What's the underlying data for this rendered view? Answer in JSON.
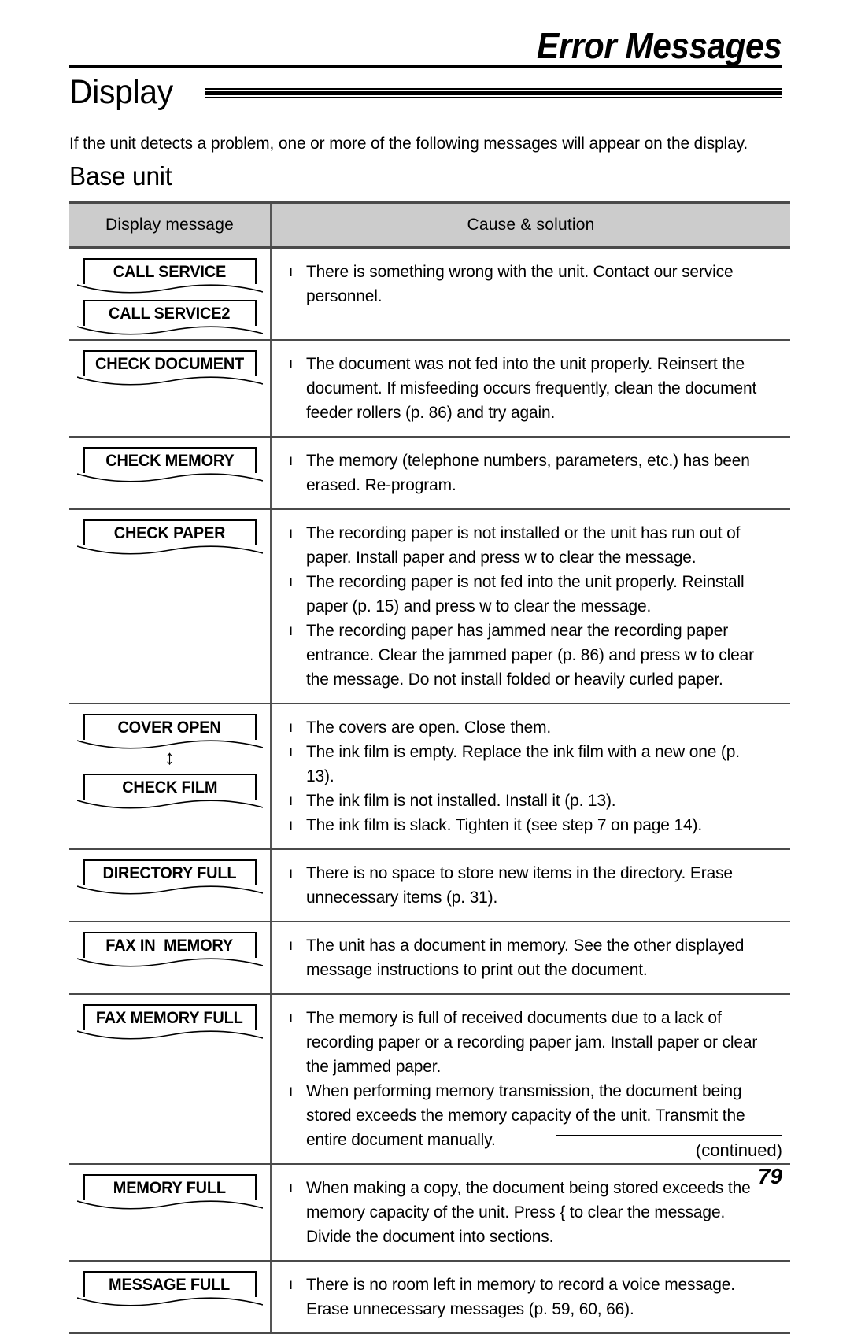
{
  "running_head": {
    "title": "Error Messages"
  },
  "section": {
    "heading": "Display",
    "intro": "If the unit detects a problem, one or more of the following messages will appear on the display.",
    "subheading": "Base unit"
  },
  "table": {
    "columns": [
      "Display message",
      "Cause & solution"
    ],
    "rows": [
      {
        "messages": [
          "CALL SERVICE",
          "CALL SERVICE2"
        ],
        "separator": "",
        "causes": [
          "There is something wrong with the unit. Contact our service personnel."
        ]
      },
      {
        "messages": [
          "CHECK DOCUMENT"
        ],
        "separator": "",
        "causes": [
          "The document was not fed into the unit properly. Reinsert the document. If misfeeding occurs frequently, clean the document feeder rollers (p. 86) and try again."
        ]
      },
      {
        "messages": [
          "CHECK MEMORY"
        ],
        "separator": "",
        "causes": [
          "The memory (telephone numbers, parameters, etc.) has been erased. Re-program."
        ]
      },
      {
        "messages": [
          "CHECK PAPER"
        ],
        "separator": "",
        "causes": [
          "The recording paper is not installed or the unit has run out of paper. Install paper and press w      to clear the message.",
          "The recording paper is not fed into the unit properly. Reinstall paper (p. 15) and press w      to clear the message.",
          "The recording paper has jammed near the recording paper entrance. Clear the jammed paper (p. 86) and press w      to clear the message. Do not install folded or heavily curled paper."
        ]
      },
      {
        "messages": [
          "COVER OPEN",
          "CHECK FILM"
        ],
        "separator": "↕",
        "causes": [
          "The covers are open. Close them.",
          "The ink film is empty. Replace the ink film with a new one (p. 13).",
          "The ink film is not installed. Install it (p. 13).",
          "The ink film is slack. Tighten it (see step 7 on page 14)."
        ]
      },
      {
        "messages": [
          "DIRECTORY FULL"
        ],
        "separator": "",
        "causes": [
          "There is no space to store new items in the directory. Erase unnecessary items (p. 31)."
        ]
      },
      {
        "messages": [
          "FAX IN  MEMORY"
        ],
        "separator": "",
        "causes": [
          "The unit has a document in memory. See the other displayed message instructions to print out the document."
        ]
      },
      {
        "messages": [
          "FAX MEMORY FULL"
        ],
        "separator": "",
        "causes": [
          "The memory is full of received documents due to a lack of recording paper or a recording paper jam. Install paper or clear the jammed paper.",
          "When performing memory transmission, the document being stored exceeds the memory capacity of the unit. Transmit the entire document manually."
        ]
      },
      {
        "messages": [
          "MEMORY FULL"
        ],
        "separator": "",
        "causes": [
          "When making a copy, the document being stored exceeds the memory capacity of the unit. Press {         to clear the message. Divide the document into sections."
        ]
      },
      {
        "messages": [
          "MESSAGE FULL"
        ],
        "separator": "",
        "causes": [
          "There is no room left in memory to record a voice message. Erase unnecessary messages (p. 59, 60, 66)."
        ]
      }
    ]
  },
  "footer": {
    "continued": "(continued)",
    "page_number": "79"
  },
  "bullet_glyph": "ı",
  "colors": {
    "header_fill": "#cccccc",
    "rule": "#000000",
    "text": "#000000"
  }
}
